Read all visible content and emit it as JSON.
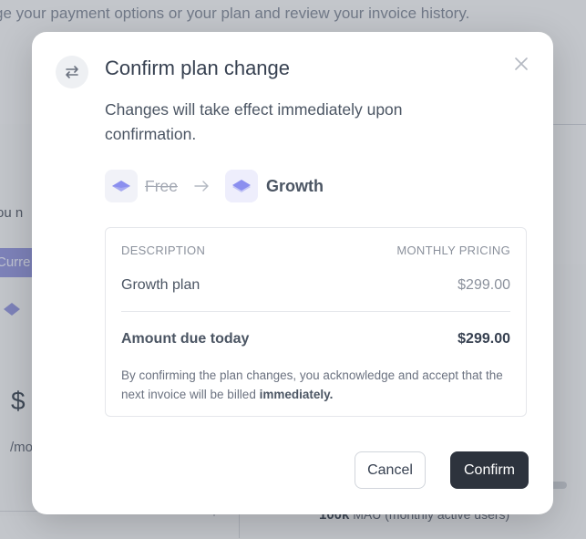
{
  "background": {
    "subtitle": "ge your payment options or your plan and review your invoice history.",
    "side_text": "ou n",
    "badge": "Curre",
    "price_symbol": "$",
    "per": "/mo",
    "mau_value": "100k",
    "mau_label": "MAU (monthly active users)"
  },
  "modal": {
    "title": "Confirm plan change",
    "description": "Changes will take effect immediately upon confirmation.",
    "from_plan": "Free",
    "to_plan": "Growth",
    "table": {
      "col_description": "DESCRIPTION",
      "col_pricing": "MONTHLY PRICING",
      "item_name": "Growth plan",
      "item_price": "$299.00",
      "total_label": "Amount due today",
      "total_price": "$299.00"
    },
    "note_prefix": "By confirming the plan changes, you acknowledge and accept that the next invoice will be billed",
    "note_emphasis": "immediately.",
    "cancel_label": "Cancel",
    "confirm_label": "Confirm"
  },
  "colors": {
    "accent": "#8b8fef",
    "confirm_bg": "#2d333d"
  },
  "icons": {
    "header": "swap-arrows-icon",
    "close": "close-icon",
    "plan": "layers-diamond-icon",
    "arrow": "arrow-right-icon"
  }
}
